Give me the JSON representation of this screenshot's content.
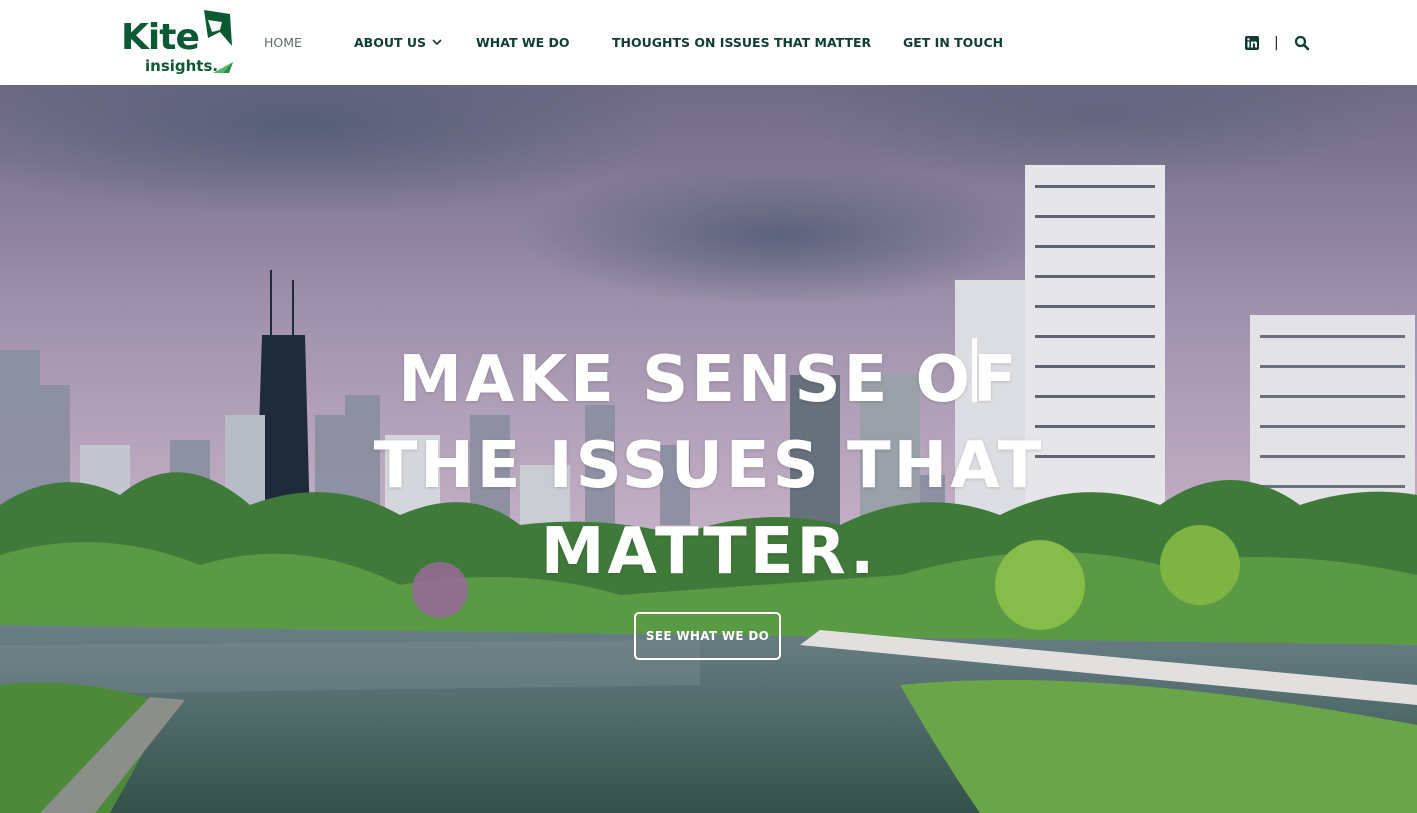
{
  "brand": {
    "logo_name": "Kite",
    "logo_tagline": "insights.",
    "primary_color": "#0c5a34",
    "accent_color": "#3fae5d"
  },
  "nav": {
    "items": [
      {
        "label": "HOME",
        "active": true
      },
      {
        "label": "ABOUT US",
        "has_dropdown": true
      },
      {
        "label": "WHAT WE DO"
      },
      {
        "label": "THOUGHTS ON ISSUES THAT MATTER"
      },
      {
        "label": "GET IN TOUCH"
      }
    ],
    "divider": "|",
    "icons": [
      "linkedin-icon",
      "search-icon"
    ]
  },
  "hero": {
    "headline_lines": [
      "MAKE SENSE OF",
      "THE ISSUES THAT",
      "MATTER."
    ],
    "cta_label": "SEE WHAT WE DO"
  }
}
